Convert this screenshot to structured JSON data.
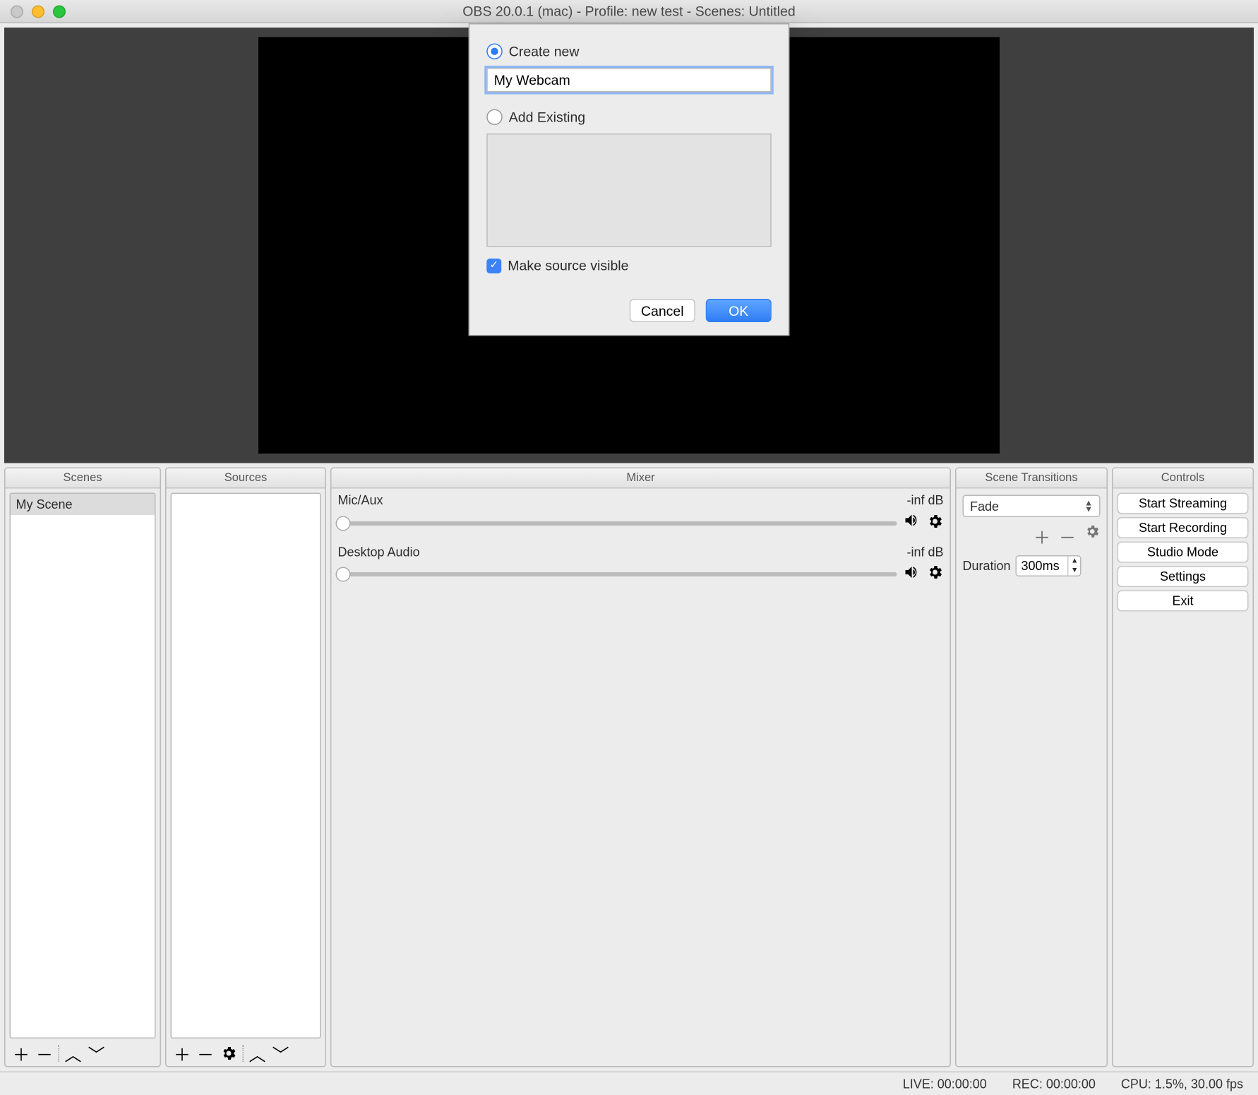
{
  "window": {
    "title": "OBS 20.0.1 (mac) - Profile: new test - Scenes: Untitled"
  },
  "dialog": {
    "create_new_label": "Create new",
    "name_value": "My Webcam",
    "add_existing_label": "Add Existing",
    "visible_label": "Make source visible",
    "cancel": "Cancel",
    "ok": "OK"
  },
  "panels": {
    "scenes": {
      "title": "Scenes",
      "items": [
        "My Scene"
      ]
    },
    "sources": {
      "title": "Sources"
    },
    "mixer": {
      "title": "Mixer",
      "items": [
        {
          "name": "Mic/Aux",
          "level": "-inf dB"
        },
        {
          "name": "Desktop Audio",
          "level": "-inf dB"
        }
      ]
    },
    "transitions": {
      "title": "Scene Transitions",
      "selected": "Fade",
      "duration_label": "Duration",
      "duration_value": "300ms"
    },
    "controls": {
      "title": "Controls",
      "buttons": [
        "Start Streaming",
        "Start Recording",
        "Studio Mode",
        "Settings",
        "Exit"
      ]
    }
  },
  "status": {
    "live": "LIVE: 00:00:00",
    "rec": "REC: 00:00:00",
    "cpu": "CPU: 1.5%, 30.00 fps"
  }
}
